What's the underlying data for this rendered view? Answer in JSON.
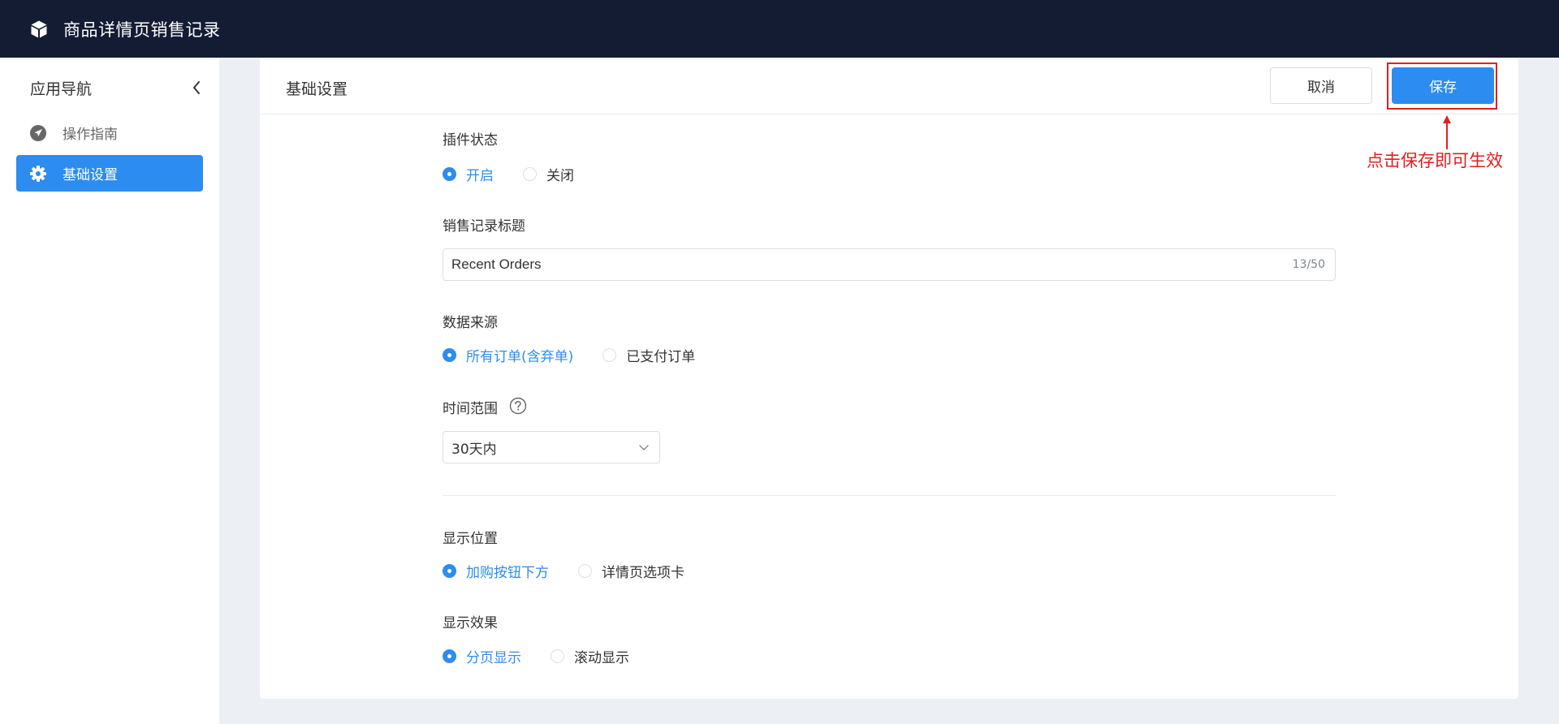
{
  "app": {
    "title": "商品详情页销售记录",
    "logo_icon": "cube-icon"
  },
  "sidebar": {
    "title": "应用导航",
    "collapse_icon": "chevron-left-icon",
    "items": [
      {
        "label": "操作指南",
        "icon": "navigation-arrow-icon",
        "active": false
      },
      {
        "label": "基础设置",
        "icon": "gear-icon",
        "active": true
      }
    ]
  },
  "header": {
    "title": "基础设置",
    "cancel_label": "取消",
    "save_label": "保存",
    "annotation": "点击保存即可生效"
  },
  "form": {
    "plugin_status": {
      "label": "插件状态",
      "options": [
        "开启",
        "关闭"
      ],
      "selected": "开启"
    },
    "sales_title": {
      "label": "销售记录标题",
      "value": "Recent Orders",
      "counter": "13/50"
    },
    "data_source": {
      "label": "数据来源",
      "options": [
        "所有订单(含弃单)",
        "已支付订单"
      ],
      "selected": "所有订单(含弃单)"
    },
    "time_range": {
      "label": "时间范围",
      "help_icon": "question-circle-icon",
      "value": "30天内"
    },
    "display_position": {
      "label": "显示位置",
      "options": [
        "加购按钮下方",
        "详情页选项卡"
      ],
      "selected": "加购按钮下方"
    },
    "display_effect": {
      "label": "显示效果",
      "options": [
        "分页显示",
        "滚动显示"
      ],
      "selected": "分页显示"
    }
  },
  "colors": {
    "topbar": "#141c33",
    "primary": "#2d8cf0",
    "annotation": "#e02020"
  }
}
